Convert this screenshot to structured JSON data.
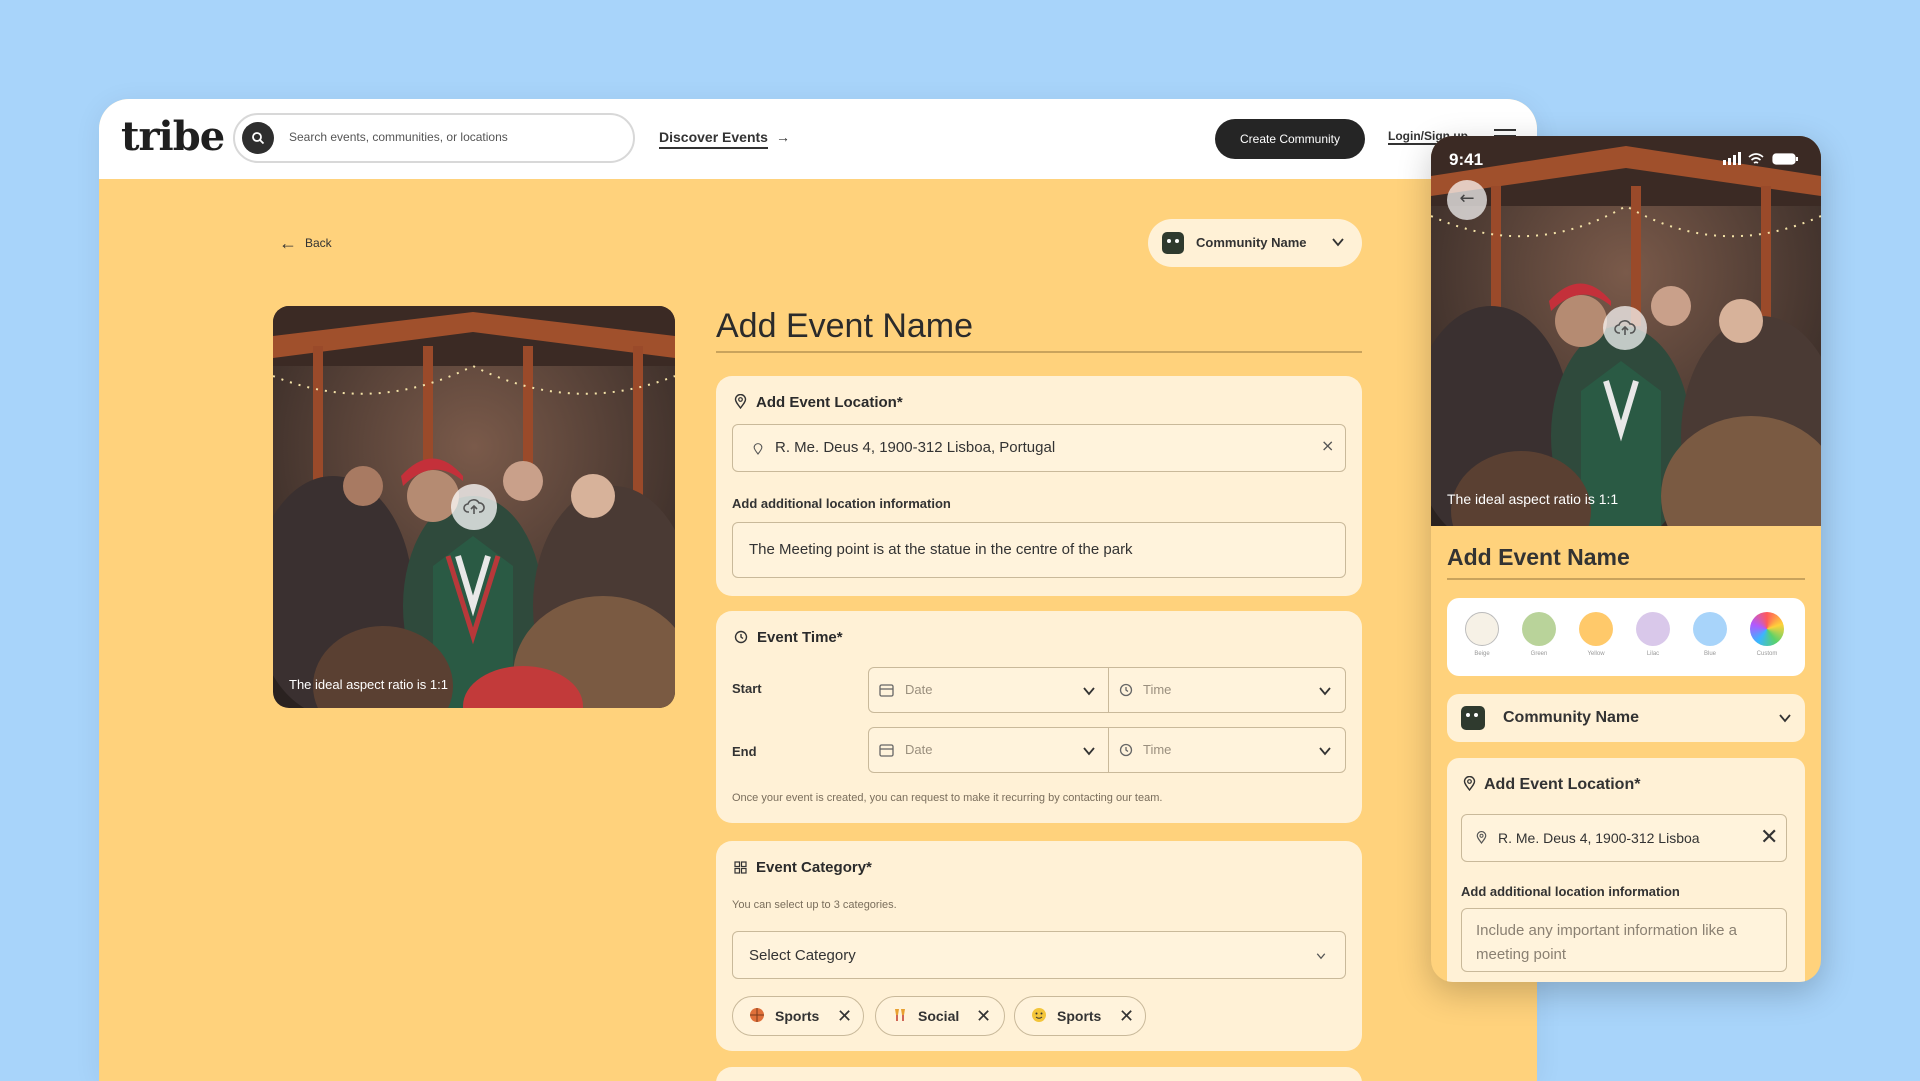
{
  "nav": {
    "logo": "tribe",
    "search_placeholder": "Search events, communities, or locations",
    "discover": "Discover Events",
    "create": "Create Community",
    "login": "Login/Sign up"
  },
  "page": {
    "back": "Back",
    "community": "Community Name",
    "title": "Add Event Name",
    "photo_caption": "The ideal aspect ratio is 1:1"
  },
  "location": {
    "heading": "Add Event Location*",
    "address": "R. Me. Deus 4, 1900-312 Lisboa, Portugal",
    "additional_label": "Add additional location information",
    "additional_value": "The Meeting point is at the statue in the centre of the park"
  },
  "time": {
    "heading": "Event Time*",
    "start": "Start",
    "end": "End",
    "date_placeholder": "Date",
    "time_placeholder": "Time",
    "note": "Once your event is created, you can request to make it recurring by contacting our team."
  },
  "category": {
    "heading": "Event Category*",
    "hint": "You can select up to 3 categories.",
    "select": "Select Category",
    "tags": [
      "Sports",
      "Social",
      "Sports"
    ]
  },
  "phone": {
    "clock": "9:41",
    "photo_caption": "The ideal aspect ratio is 1:1",
    "title": "Add Event Name",
    "colors": [
      {
        "label": "Beige",
        "hex": "#f6f1e6"
      },
      {
        "label": "Green",
        "hex": "#b9d39a"
      },
      {
        "label": "Yellow",
        "hex": "#ffc96a"
      },
      {
        "label": "Lilac",
        "hex": "#d9c8ea"
      },
      {
        "label": "Blue",
        "hex": "#a8d4fa"
      },
      {
        "label": "Custom",
        "hex": "conic"
      }
    ],
    "community": "Community Name",
    "location_heading": "Add Event Location*",
    "address": "R. Me. Deus 4, 1900-312 Lisboa",
    "additional_label": "Add additional location information",
    "additional_placeholder": "Include any important information like a meeting point"
  },
  "colors": {
    "background": "#a8d4fa",
    "panel": "#ffd27c",
    "card": "#fff1d6",
    "dark": "#252525"
  }
}
